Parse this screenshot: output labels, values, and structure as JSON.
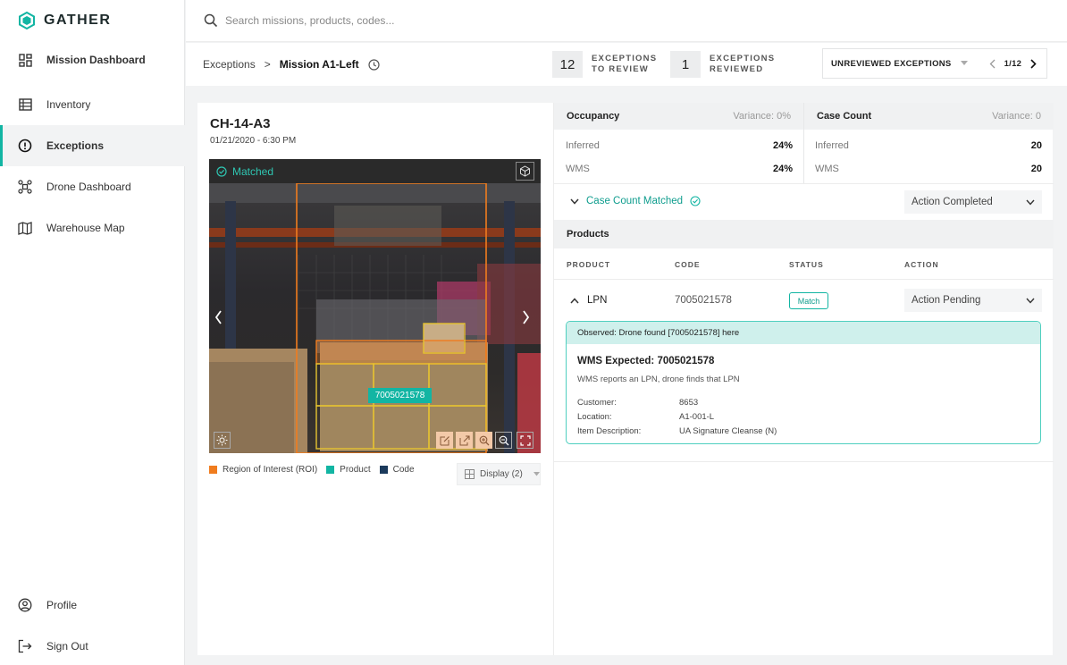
{
  "app": {
    "brand": "GATHER",
    "accent": "#12b5a3"
  },
  "sidebar": {
    "items": [
      {
        "label": "Mission Dashboard",
        "icon": "grid-icon"
      },
      {
        "label": "Inventory",
        "icon": "list-icon"
      },
      {
        "label": "Exceptions",
        "icon": "alert-circle-icon"
      },
      {
        "label": "Drone Dashboard",
        "icon": "drone-icon"
      },
      {
        "label": "Warehouse Map",
        "icon": "map-icon"
      }
    ],
    "footer": [
      {
        "label": "Profile",
        "icon": "user-circle-icon"
      },
      {
        "label": "Sign Out",
        "icon": "sign-out-icon"
      }
    ]
  },
  "search": {
    "placeholder": "Search missions, products, codes..."
  },
  "breadcrumb": {
    "parent": "Exceptions",
    "separator": ">",
    "current": "Mission A1-Left"
  },
  "stats": {
    "to_review": {
      "count": "12",
      "line1": "EXCEPTIONS",
      "line2": "TO REVIEW"
    },
    "reviewed": {
      "count": "1",
      "line1": "EXCEPTIONS",
      "line2": "REVIEWED"
    }
  },
  "filter": {
    "label": "UNREVIEWED EXCEPTIONS",
    "page": "1/12"
  },
  "location": {
    "id": "CH-14-A3",
    "datetime": "01/21/2020 - 6:30 PM"
  },
  "image": {
    "status": "Matched",
    "code_label": "7005021578"
  },
  "legend": {
    "roi": "Region of Interest (ROI)",
    "product": "Product",
    "code": "Code",
    "display": "Display (2)",
    "roi_color": "#f07c1e",
    "product_color": "#12b5a3",
    "code_color": "#1b3a5c"
  },
  "occupancy": {
    "title": "Occupancy",
    "variance": "Variance: 0%",
    "inferred_label": "Inferred",
    "inferred": "24%",
    "wms_label": "WMS",
    "wms": "24%"
  },
  "case_count": {
    "title": "Case Count",
    "variance": "Variance: 0",
    "inferred_label": "Inferred",
    "inferred": "20",
    "wms_label": "WMS",
    "wms": "20"
  },
  "case_status": {
    "label": "Case Count Matched",
    "action": "Action Completed"
  },
  "products": {
    "title": "Products",
    "columns": [
      "PRODUCT",
      "CODE",
      "STATUS",
      "ACTION"
    ],
    "rows": [
      {
        "product": "LPN",
        "code": "7005021578",
        "status": "Match",
        "action": "Action Pending"
      }
    ]
  },
  "detail": {
    "observed": "Observed: Drone found [7005021578] here",
    "title": "WMS Expected: 7005021578",
    "subtitle": "WMS reports an LPN, drone finds that LPN",
    "fields": [
      {
        "k": "Customer:",
        "v": "8653"
      },
      {
        "k": "Location:",
        "v": "A1-001-L"
      },
      {
        "k": "Item Description:",
        "v": "UA Signature Cleanse (N)"
      }
    ]
  }
}
